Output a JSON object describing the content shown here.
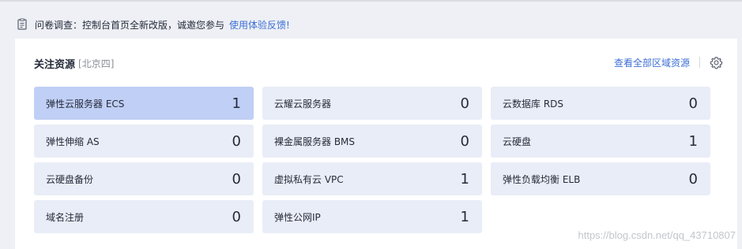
{
  "notice": {
    "text": "问卷调查：控制台首页全新改版，诚邀您参与",
    "link": "使用体验反馈!"
  },
  "card": {
    "title": "关注资源",
    "region": "[北京四]",
    "view_all": "查看全部区域资源"
  },
  "tiles": [
    {
      "name": "弹性云服务器 ECS",
      "count": "1"
    },
    {
      "name": "云耀云服务器",
      "count": "0"
    },
    {
      "name": "云数据库 RDS",
      "count": "0"
    },
    {
      "name": "弹性伸缩 AS",
      "count": "0"
    },
    {
      "name": "裸金属服务器 BMS",
      "count": "0"
    },
    {
      "name": "云硬盘",
      "count": "1"
    },
    {
      "name": "云硬盘备份",
      "count": "0"
    },
    {
      "name": "虚拟私有云 VPC",
      "count": "1"
    },
    {
      "name": "弹性负载均衡 ELB",
      "count": "0"
    },
    {
      "name": "域名注册",
      "count": "0"
    },
    {
      "name": "弹性公网IP",
      "count": "1"
    }
  ],
  "watermark": "https://blog.csdn.net/qq_43710807",
  "colors": {
    "accent": "#3d6fd6",
    "tile_bg": "#e9edf7",
    "tile_active_bg": "#c0cff5"
  },
  "icons": {
    "notice": "survey-icon",
    "settings": "gear-icon"
  }
}
